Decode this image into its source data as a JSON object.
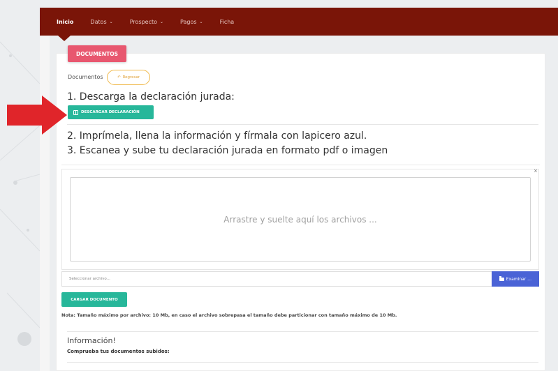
{
  "nav": {
    "items": [
      {
        "label": "Inicio",
        "active": true,
        "caret": false
      },
      {
        "label": "Datos",
        "active": false,
        "caret": true
      },
      {
        "label": "Prospecto",
        "active": false,
        "caret": true
      },
      {
        "label": "Pagos",
        "active": false,
        "caret": true
      },
      {
        "label": "Ficha",
        "active": false,
        "caret": false
      }
    ]
  },
  "tab": {
    "label": "DOCUMENTOS"
  },
  "section": {
    "label": "Documentos",
    "return_label": "Regresar"
  },
  "steps": {
    "step1": "1. Descarga la declaración jurada:",
    "download_label": "DESCARGAR DECLARACIÓN",
    "step2": "2. Imprímela, llena la información y fírmala con lapicero azul.",
    "step3": "3. Escanea y sube tu declaración jurada en formato pdf o imagen"
  },
  "upload": {
    "drop_text": "Arrastre y suelte aquí los archivos ...",
    "close_label": "×",
    "file_placeholder": "Seleccionar archivo...",
    "browse_label": "Examinar …",
    "load_label": "CARGAR DOCUMENTO"
  },
  "note": "Nota: Tamaño máximo por archivo: 10 Mb, en caso el archivo sobrepasa el tamaño debe particionar con tamaño máximo de 10 Mb.",
  "info": {
    "title": "Información!",
    "subtitle": "Comprueba tus documentos subidos:"
  },
  "colors": {
    "topbar": "#7a1508",
    "tab": "#e8576f",
    "primary_green": "#27b79a",
    "browse_blue": "#4a63d6",
    "return_orange": "#f0b94a",
    "arrow_red": "#e0252a"
  }
}
